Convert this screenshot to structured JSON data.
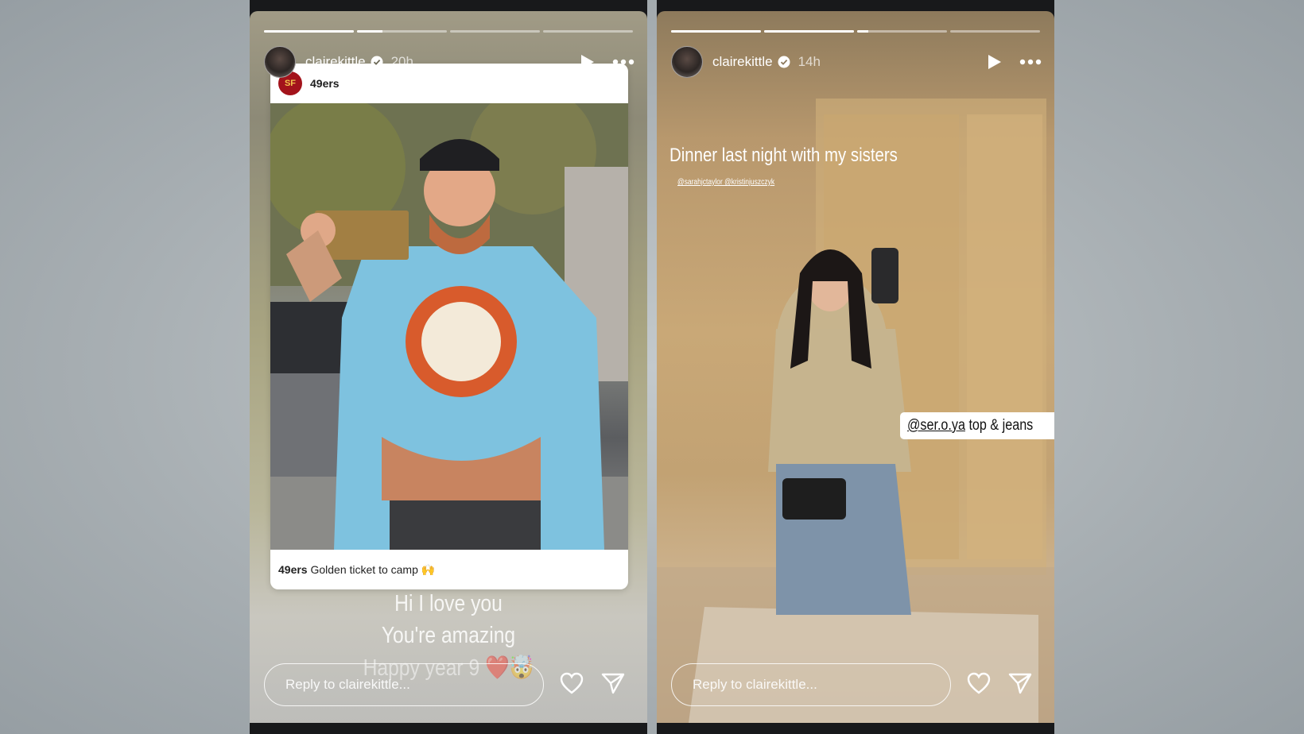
{
  "left_story": {
    "username": "clairekittle",
    "time": "20h",
    "progress": [
      1,
      0.28,
      0,
      0
    ],
    "shared_post": {
      "account": "49ers",
      "caption_user": "49ers",
      "caption_text": "Golden ticket to camp 🙌"
    },
    "overlay_lines": [
      "Hi I love you",
      "You're amazing",
      "Happy year 9 ❤️🤯"
    ],
    "reply_placeholder": "Reply to clairekittle..."
  },
  "right_story": {
    "username": "clairekittle",
    "time": "14h",
    "progress": [
      1,
      1,
      0.12,
      0
    ],
    "caption": "Dinner last night with my sisters",
    "mentions": "@sarahjctaylor @kristinjuszczyk",
    "tag_link": "@ser.o.ya",
    "tag_text": " top & jeans",
    "reply_placeholder": "Reply to clairekittle..."
  },
  "icons": {
    "verified_color": "#3897f0",
    "play": "play-icon",
    "more": "more-icon",
    "like": "heart-icon",
    "share": "send-icon"
  }
}
